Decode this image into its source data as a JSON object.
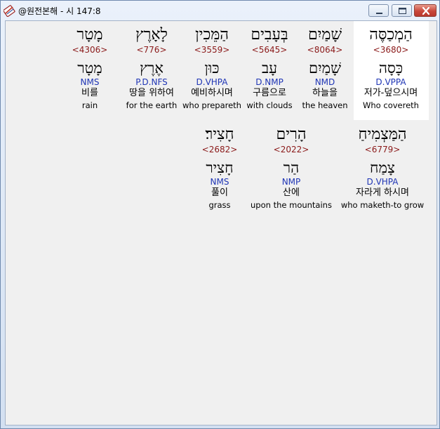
{
  "window": {
    "title": "@원전본해 - 시 147:8"
  },
  "icons": {
    "app": "bible-app-icon",
    "minimize": "minimize-icon",
    "maximize": "maximize-icon",
    "close": "close-icon"
  },
  "rows": [
    {
      "words": [
        {
          "hebrew": "מָטָר",
          "strong": "<4306>",
          "lemma": "מָטָר",
          "morph": "NMS",
          "korean": "비를",
          "english": "rain"
        },
        {
          "hebrew": "לָאָרֶץ",
          "strong": "<776>",
          "lemma": "אֶרֶץ",
          "morph": "P.D.NFS",
          "korean": "땅을 위하여",
          "english": "for the earth"
        },
        {
          "hebrew": "הַמֵּכִין",
          "strong": "<3559>",
          "lemma": "כּוּן",
          "morph": "D.VHPA",
          "korean": "예비하시며",
          "english": "who prepareth"
        },
        {
          "hebrew": "בְּעָבִים",
          "strong": "<5645>",
          "lemma": "עָב",
          "morph": "D.NMP",
          "korean": "구름으로",
          "english": "with clouds"
        },
        {
          "hebrew": "שָׁמַיִם",
          "strong": "<8064>",
          "lemma": "שָׁמַיִם",
          "morph": "NMD",
          "korean": "하늘을",
          "english": "the heaven"
        },
        {
          "hebrew": "הַמְכַסֶּה",
          "strong": "<3680>",
          "lemma": "כָּסָה",
          "morph": "D.VPPA",
          "korean": "저가-덮으시며",
          "english": "Who covereth"
        }
      ]
    },
    {
      "words": [
        {
          "hebrew": "חָצִיר׃",
          "strong": "<2682>",
          "lemma": "חָצִיר",
          "morph": "NMS",
          "korean": "풀이",
          "english": "grass"
        },
        {
          "hebrew": "הָרִים",
          "strong": "<2022>",
          "lemma": "הַר",
          "morph": "NMP",
          "korean": "산에",
          "english": "upon the mountains"
        },
        {
          "hebrew": "הַמַּצְמִיחַ",
          "strong": "<6779>",
          "lemma": "צָמַח",
          "morph": "D.VHPA",
          "korean": "자라게 하시며",
          "english": "who maketh-to grow"
        }
      ]
    }
  ]
}
